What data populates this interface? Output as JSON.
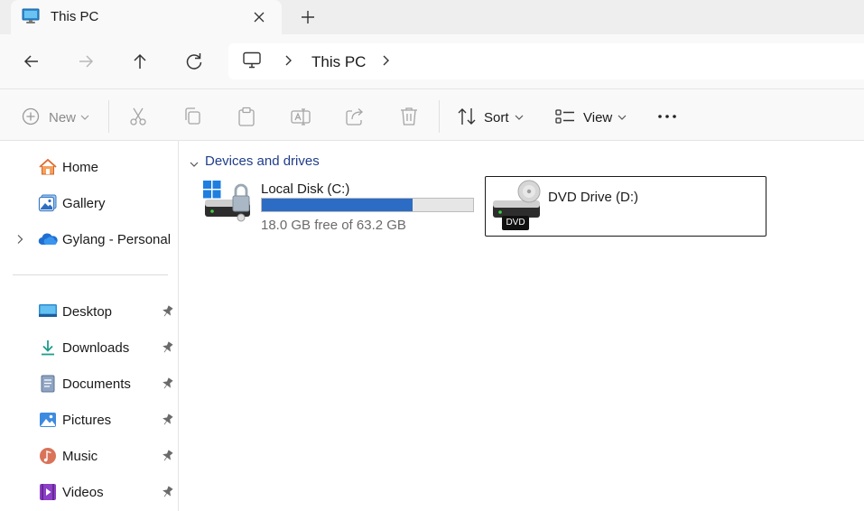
{
  "tab": {
    "title": "This PC",
    "icon": "monitor-icon"
  },
  "address": {
    "crumbs": [
      "This PC"
    ],
    "icon": "computer-icon"
  },
  "commands": {
    "new_label": "New",
    "sort_label": "Sort",
    "view_label": "View"
  },
  "sidebar": {
    "top_items": [
      {
        "label": "Home",
        "icon": "home-icon"
      },
      {
        "label": "Gallery",
        "icon": "gallery-icon"
      },
      {
        "label": "Gylang - Personal",
        "icon": "onedrive-cloud-icon"
      }
    ],
    "quick_access": [
      {
        "label": "Desktop",
        "icon": "desktop-icon"
      },
      {
        "label": "Downloads",
        "icon": "downloads-icon"
      },
      {
        "label": "Documents",
        "icon": "documents-icon"
      },
      {
        "label": "Pictures",
        "icon": "pictures-icon"
      },
      {
        "label": "Music",
        "icon": "music-icon"
      },
      {
        "label": "Videos",
        "icon": "videos-icon"
      }
    ]
  },
  "content": {
    "group_title": "Devices and drives",
    "drives": [
      {
        "name": "Local Disk (C:)",
        "free_text": "18.0 GB free of 63.2 GB",
        "used_fraction": 0.715,
        "icon": "windows-locked-drive-icon"
      },
      {
        "name": "DVD Drive (D:)",
        "badge": "DVD",
        "icon": "dvd-drive-icon"
      }
    ]
  },
  "colors": {
    "accent": "#2d6cc4",
    "group_title": "#1f3d8a",
    "chrome_bg": "#eeeeee",
    "bar_bg": "#f9f9f9"
  }
}
